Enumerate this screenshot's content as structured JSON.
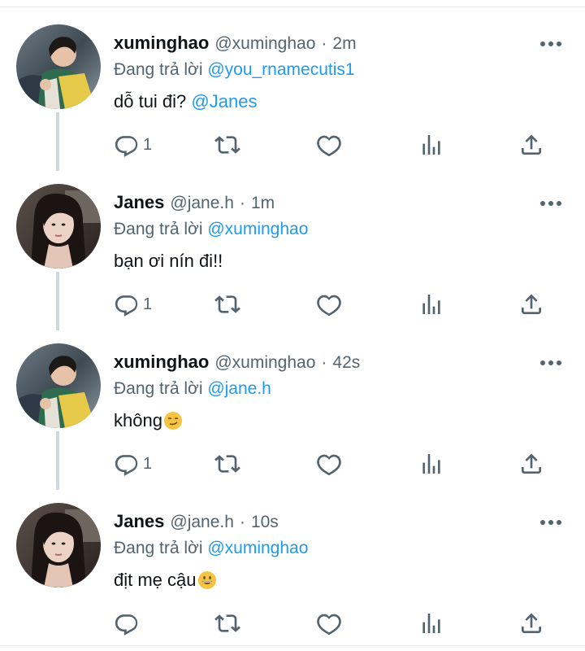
{
  "reply_prefix": "Đang trả lời",
  "tweets": [
    {
      "name": "xuminghao",
      "handle": "@xuminghao",
      "time_sep": "·",
      "time": "2m",
      "reply_to": "@you_rnamecutis1",
      "text": "dỗ tui đi?",
      "text_mention": "@Janes",
      "reply_count": "1",
      "avatar": "avatar-xuminghao"
    },
    {
      "name": "Janes",
      "handle": "@jane.h",
      "time_sep": "·",
      "time": "1m",
      "reply_to": "@xuminghao",
      "text": "bạn ơi nín đi!!",
      "reply_count": "1",
      "avatar": "avatar-janes"
    },
    {
      "name": "xuminghao",
      "handle": "@xuminghao",
      "time_sep": "·",
      "time": "42s",
      "reply_to": "@jane.h",
      "text": "không",
      "emoji": "smirking-face-emoji",
      "reply_count": "1",
      "avatar": "avatar-xuminghao"
    },
    {
      "name": "Janes",
      "handle": "@jane.h",
      "time_sep": "·",
      "time": "10s",
      "reply_to": "@xuminghao",
      "text": "địt mẹ cậu",
      "emoji": "grinning-face-emoji",
      "reply_count": "",
      "avatar": "avatar-janes"
    }
  ],
  "colors": {
    "link": "#1d9bf0",
    "secondary_text": "#536471",
    "thread_line": "#cfd9de",
    "divider": "#e6ecf0"
  }
}
